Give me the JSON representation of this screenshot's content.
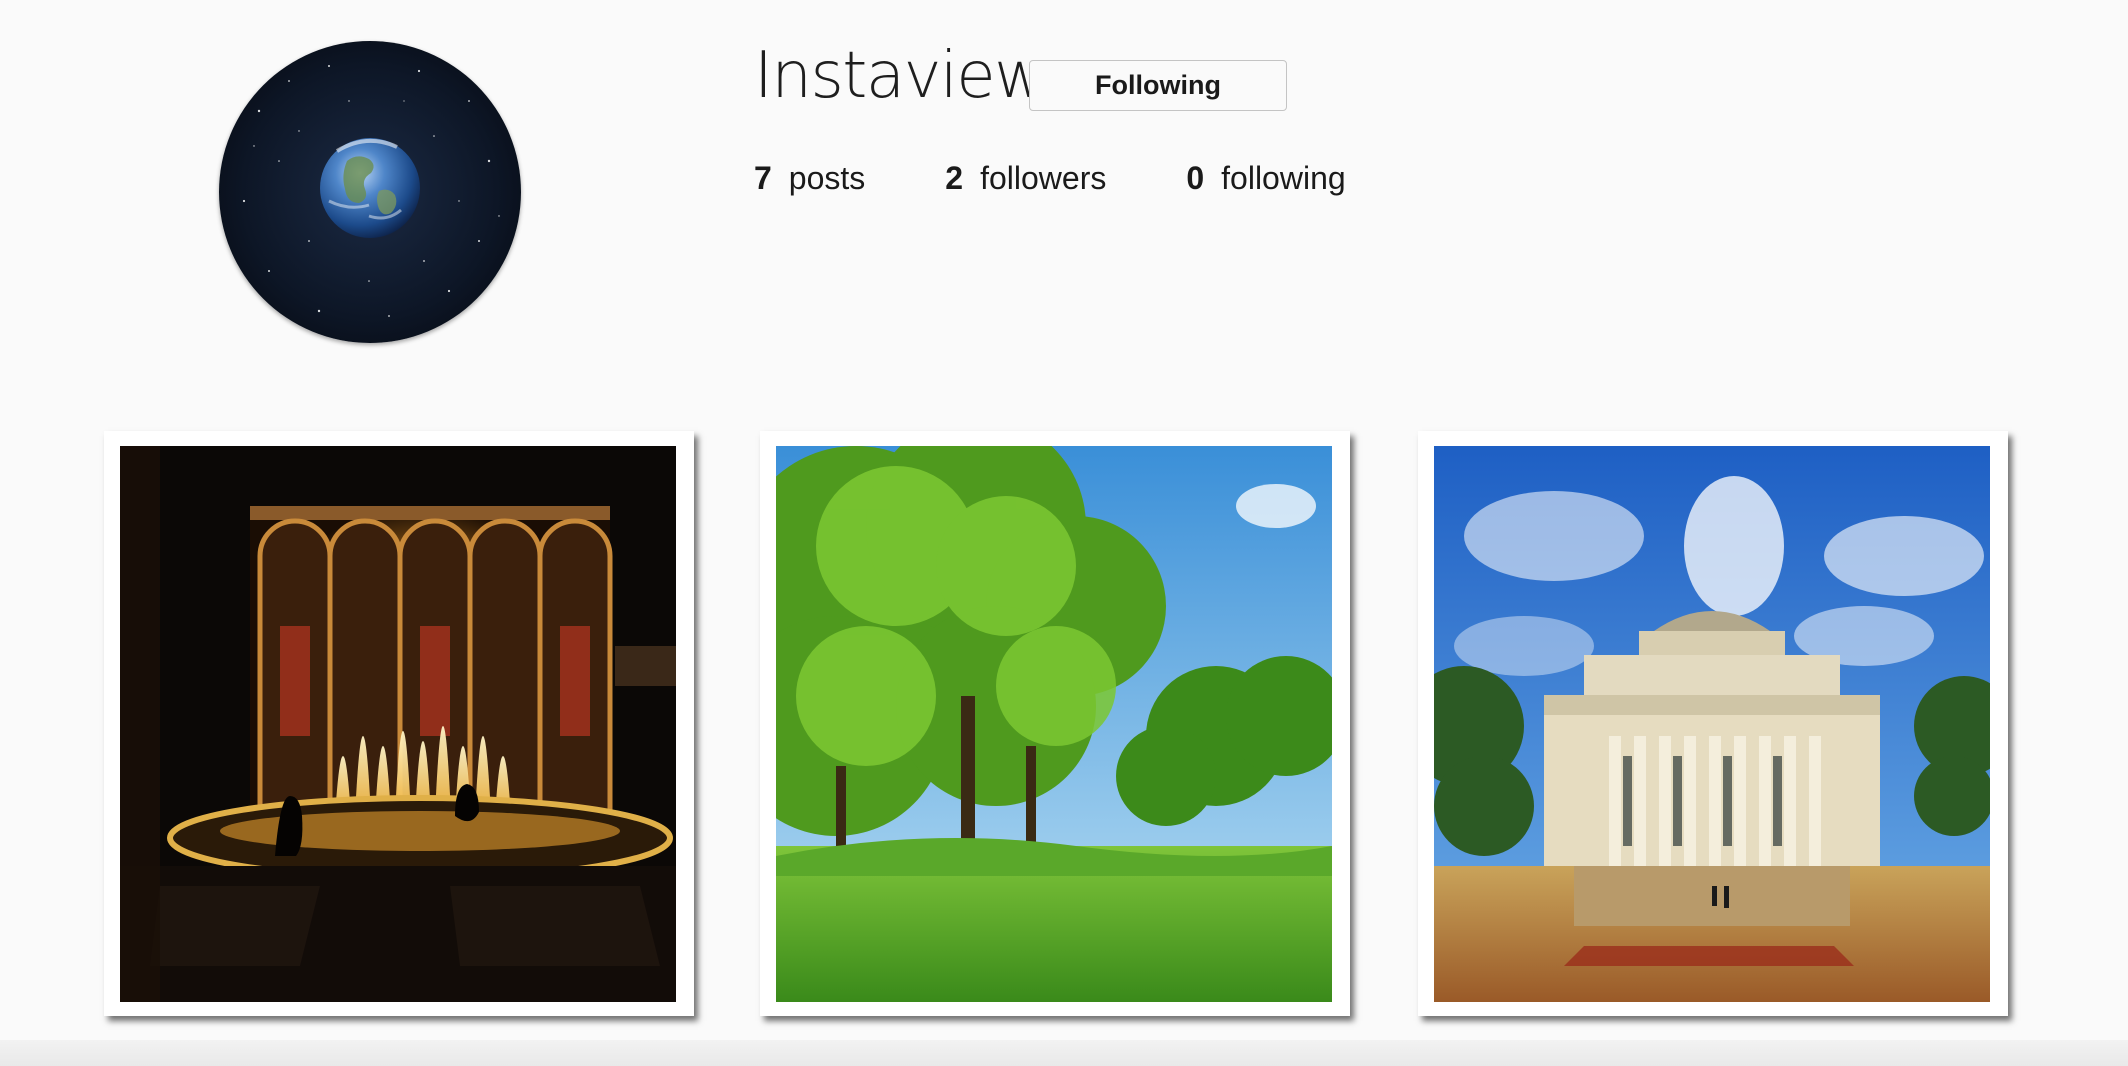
{
  "profile": {
    "username": "Instaview",
    "follow_button_label": "Following",
    "avatar_icon": "earth-in-space-avatar"
  },
  "stats": {
    "posts_count": "7",
    "posts_label": "posts",
    "followers_count": "2",
    "followers_label": "followers",
    "following_count": "0",
    "following_label": "following"
  },
  "posts": [
    {
      "icon": "opera-house-fountain-night-photo"
    },
    {
      "icon": "park-trees-lawn-photo"
    },
    {
      "icon": "domed-library-columns-photo"
    }
  ],
  "colors": {
    "background": "#fafafa",
    "text": "#262626",
    "button_border": "#c4c4c4"
  }
}
